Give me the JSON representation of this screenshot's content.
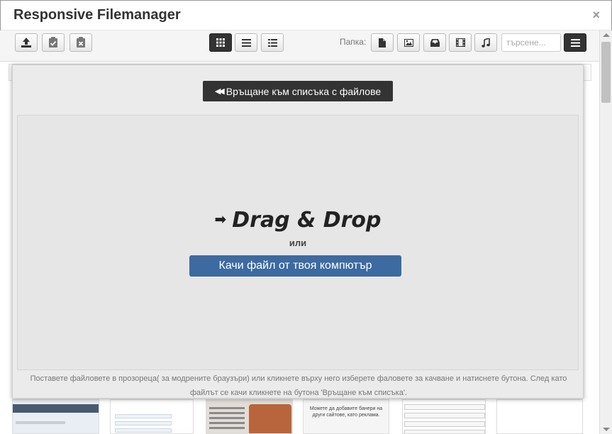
{
  "modal": {
    "title": "Responsive Filemanager",
    "close_label": "×"
  },
  "toolbar": {
    "buttons": [
      {
        "icon": "upload-icon",
        "active": true
      },
      {
        "icon": "paste-icon",
        "active": false
      },
      {
        "icon": "clear-clipboard-icon",
        "active": false
      }
    ],
    "view_modes": [
      {
        "icon": "grid-view-icon",
        "active": true
      },
      {
        "icon": "list-view-icon",
        "active": false
      },
      {
        "icon": "columns-view-icon",
        "active": false
      }
    ],
    "folder_label": "Папка:",
    "filters": [
      {
        "icon": "file-icon"
      },
      {
        "icon": "image-icon"
      },
      {
        "icon": "archive-icon"
      },
      {
        "icon": "video-icon"
      },
      {
        "icon": "music-icon"
      }
    ],
    "search_placeholder": "търсене...",
    "menu_icon": "menu-icon"
  },
  "uploader": {
    "back_label": "Връщане към списъка с файлове",
    "drag_drop_title": "Drag & Drop",
    "or_label": "или",
    "upload_button_label": "Качи файл от твоя компютър",
    "help_text": "Поставете файловете в прозореца( за модрените браузъри) или кликнете върху него изберете фаловете за качване и натиснете бутона. След като файлът се качи кликнете на бутона 'Връщане към списъка'."
  },
  "thumbnails": {
    "banner_caption": "Можете да добавите банери на други сайтове, като реклама."
  },
  "colors": {
    "primary_button": "#3c6aa1",
    "dark_button": "#333333",
    "annotation": "#e0201f"
  }
}
